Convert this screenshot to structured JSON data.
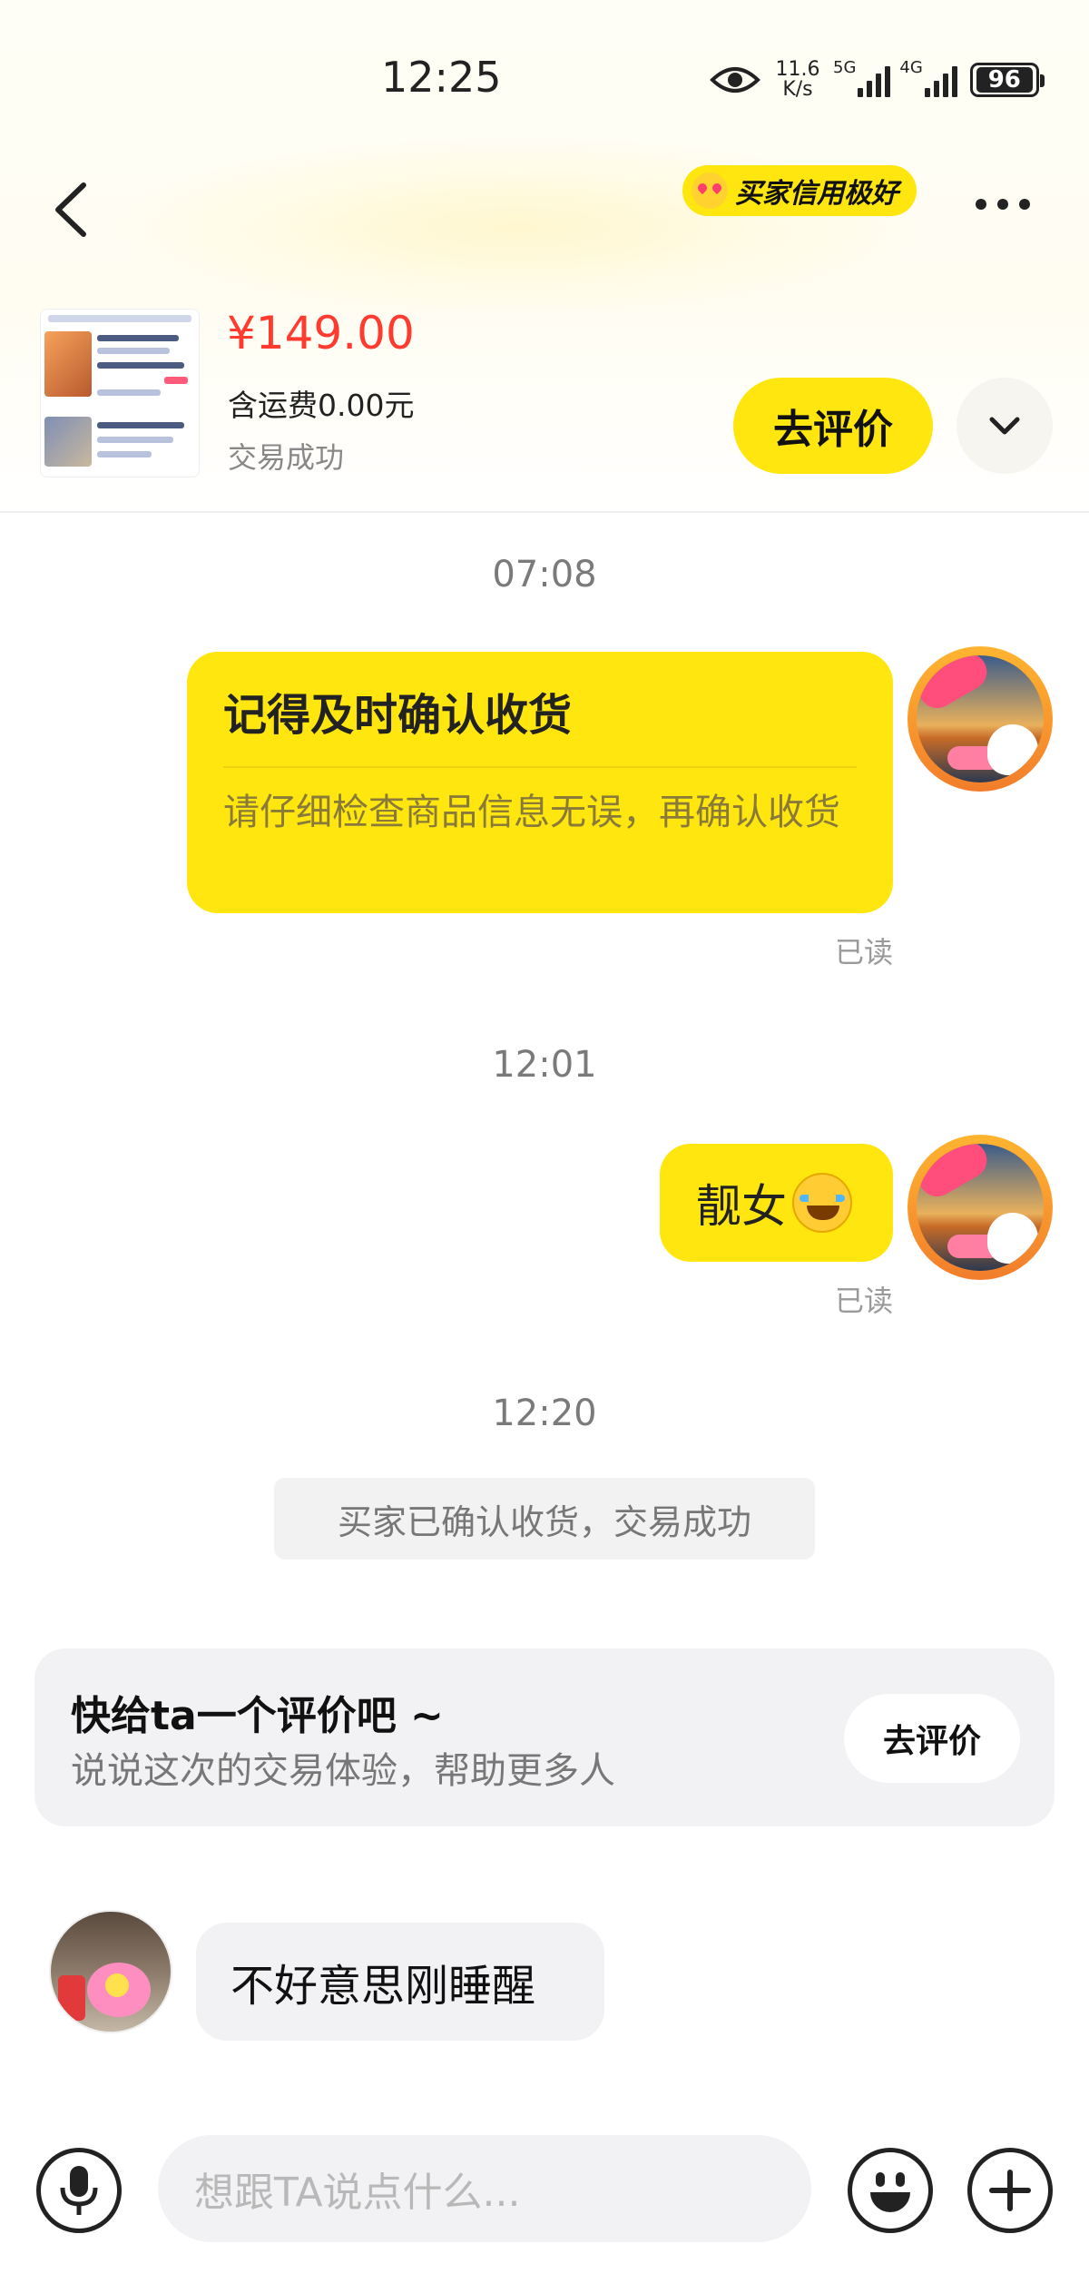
{
  "status_bar": {
    "time": "12:25",
    "net_speed_value": "11.6",
    "net_speed_unit": "K/s",
    "signal1_label": "5G",
    "signal2_label": "4G",
    "battery": "96"
  },
  "header": {
    "credit_badge": "买家信用极好"
  },
  "product": {
    "price": "¥149.00",
    "shipping": "含运费0.00元",
    "status": "交易成功",
    "review_button": "去评价"
  },
  "chat": {
    "messages": [
      {
        "time": "07:08",
        "card_title": "记得及时确认收货",
        "card_body": "请仔细检查商品信息无误，再确认收货",
        "read": "已读"
      },
      {
        "time": "12:01",
        "text": "靓女",
        "read": "已读"
      },
      {
        "time": "12:20",
        "system_notice": "买家已确认收货，交易成功"
      }
    ],
    "review_prompt": {
      "title": "快给ta一个评价吧 ~",
      "subtitle": "说说这次的交易体验，帮助更多人",
      "button": "去评价"
    },
    "other_message": "不好意思刚睡醒"
  },
  "input_bar": {
    "placeholder": "想跟TA说点什么..."
  },
  "icons": [
    "eye-icon",
    "back-icon",
    "more-icon",
    "chevron-down-icon",
    "laugh-emoji-icon",
    "mic-icon",
    "emoji-icon",
    "plus-icon"
  ]
}
